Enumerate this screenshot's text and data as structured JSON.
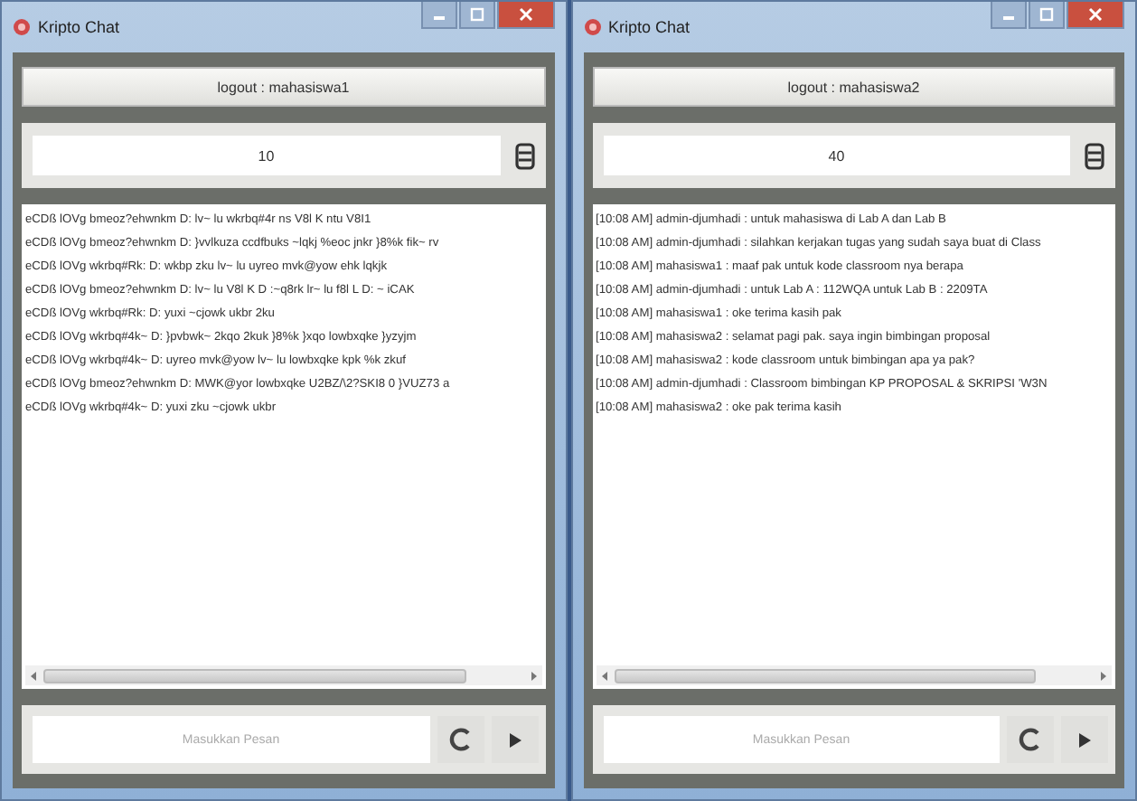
{
  "windows": [
    {
      "title": "Kripto Chat",
      "logout_button": "logout : mahasiswa1",
      "key_field": {
        "value": "10"
      },
      "messages": [
        "eCDß lOVg bmeoz?ehwnkm D: lv~ lu wkrbq#4r ns V8l K ntu V8I1",
        "eCDß lOVg bmeoz?ehwnkm D: }vvlkuza ccdfbuks ~lqkj %eoc jnkr }8%k fik~ rv",
        "eCDß lOVg wkrbq#Rk: D: wkbp zku lv~ lu uyreo mvk@yow ehk lqkjk",
        "eCDß lOVg bmeoz?ehwnkm D: lv~ lu V8l K D :~q8rk lr~ lu f8l L D: ~ iCAK",
        "eCDß lOVg wkrbq#Rk: D: yuxi ~cjowk ukbr 2ku",
        "eCDß lOVg wkrbq#4k~ D: }pvbwk~ 2kqo 2kuk }8%k }xqo lowbxqke }yzyjm",
        "eCDß lOVg wkrbq#4k~ D: uyreo mvk@yow lv~ lu lowbxqke kpk %k zkuf",
        "eCDß lOVg bmeoz?ehwnkm D: MWK@yor lowbxqke U2BZ/\\2?SKI8 0 }VUZ73 a",
        "eCDß lOVg wkrbq#4k~ D: yuxi zku ~cjowk ukbr"
      ],
      "message_placeholder": "Masukkan Pesan"
    },
    {
      "title": "Kripto Chat",
      "logout_button": "logout : mahasiswa2",
      "key_field": {
        "value": "40"
      },
      "messages": [
        "[10:08 AM] admin-djumhadi : untuk mahasiswa di Lab A dan Lab B",
        "[10:08 AM] admin-djumhadi : silahkan kerjakan tugas yang sudah saya buat di Class",
        "[10:08 AM] mahasiswa1 : maaf pak untuk kode classroom nya berapa",
        "[10:08 AM] admin-djumhadi : untuk Lab A : 112WQA untuk Lab B : 2209TA",
        "[10:08 AM] mahasiswa1 : oke terima kasih pak",
        "[10:08 AM] mahasiswa2 : selamat pagi pak. saya ingin bimbingan proposal",
        "[10:08 AM] mahasiswa2 : kode classroom untuk bimbingan apa ya pak?",
        "[10:08 AM] admin-djumhadi : Classroom bimbingan KP PROPOSAL & SKRIPSI 'W3N",
        "[10:08 AM] mahasiswa2 : oke pak terima kasih"
      ],
      "message_placeholder": "Masukkan Pesan"
    }
  ]
}
